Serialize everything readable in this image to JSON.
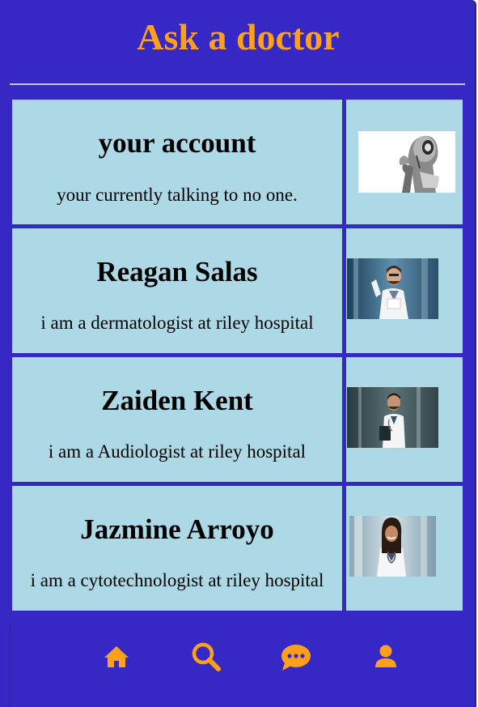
{
  "app": {
    "title": "Ask a doctor"
  },
  "list": [
    {
      "name": "your account",
      "description": "your currently talking to no one.",
      "image_icon": "robot-thinker-image"
    },
    {
      "name": "Reagan Salas",
      "description": "i am a dermatologist at riley hospital",
      "image_icon": "male-doctor-glasses-image"
    },
    {
      "name": "Zaiden Kent",
      "description": "i am a Audiologist at riley hospital",
      "image_icon": "male-doctor-tablet-image"
    },
    {
      "name": "Jazmine Arroyo",
      "description": "i am a cytotechnologist at riley hospital",
      "image_icon": "female-doctor-image"
    }
  ],
  "nav": {
    "items": [
      {
        "icon": "home-icon"
      },
      {
        "icon": "search-icon"
      },
      {
        "icon": "chat-icon"
      },
      {
        "icon": "user-icon"
      }
    ]
  },
  "colors": {
    "background": "#3628c5",
    "accent": "#ffa01c",
    "card": "#add8e6",
    "text": "#000000"
  }
}
